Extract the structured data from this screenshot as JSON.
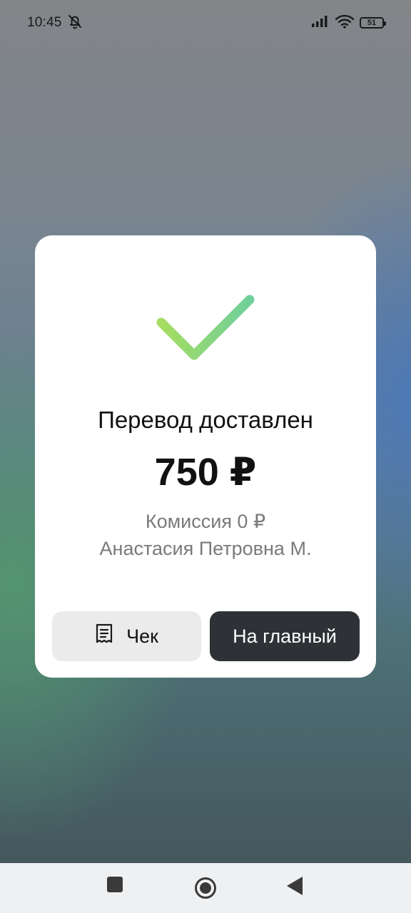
{
  "status_bar": {
    "time": "10:45",
    "battery_level": "51",
    "icons": [
      "bell-off-icon",
      "signal-icon",
      "wifi-icon",
      "battery-icon"
    ]
  },
  "result": {
    "title": "Перевод доставлен",
    "amount": "750 ₽",
    "commission": "Комиссия 0 ₽",
    "recipient": "Анастасия Петровна М.",
    "status_icon": "checkmark-icon",
    "check_colors": [
      "#a6dd62",
      "#6fcf9a"
    ]
  },
  "actions": {
    "receipt_label": "Чек",
    "receipt_icon": "receipt-icon",
    "home_label": "На главный"
  },
  "nav_bar": {
    "icons": [
      "recents-square-icon",
      "home-circle-icon",
      "back-triangle-icon"
    ]
  },
  "colors": {
    "card": "#ffffff",
    "primary_button": "#2e3236",
    "secondary_button": "#ebebeb",
    "muted_text": "#7a7a7a"
  }
}
